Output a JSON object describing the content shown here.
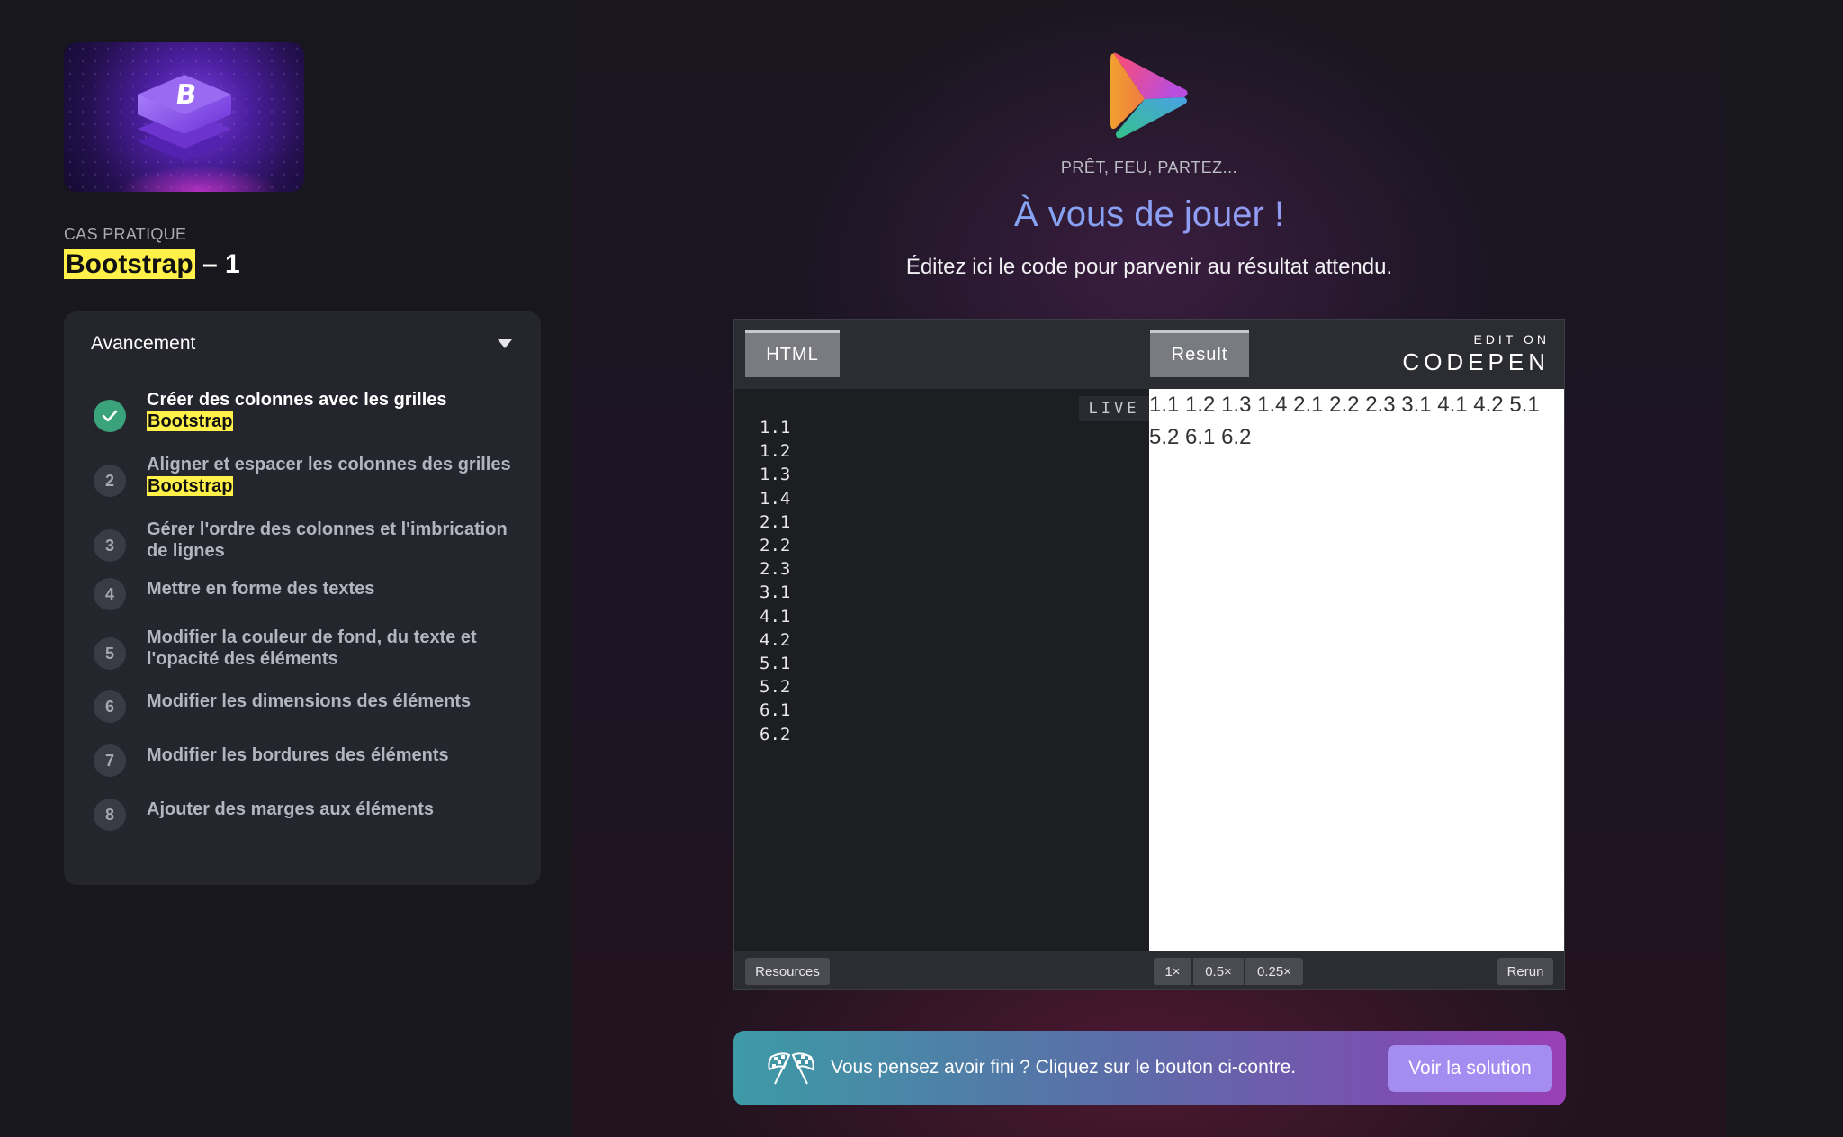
{
  "sidebar": {
    "category": "CAS PRATIQUE",
    "course_title_highlight": "Bootstrap",
    "course_title_rest": " – 1",
    "progress_title": "Avancement",
    "steps": [
      {
        "num": "",
        "done": true,
        "text": "Créer des colonnes avec les grilles",
        "highlight": "Bootstrap"
      },
      {
        "num": "2",
        "done": false,
        "text": "Aligner et espacer les colonnes des grilles",
        "highlight": "Bootstrap"
      },
      {
        "num": "3",
        "done": false,
        "text": "Gérer l'ordre des colonnes et l'imbrication de lignes",
        "highlight": ""
      },
      {
        "num": "4",
        "done": false,
        "text": "Mettre en forme des textes",
        "highlight": ""
      },
      {
        "num": "5",
        "done": false,
        "text": "Modifier la couleur de fond, du texte et l'opacité des éléments",
        "highlight": ""
      },
      {
        "num": "6",
        "done": false,
        "text": "Modifier les dimensions des éléments",
        "highlight": ""
      },
      {
        "num": "7",
        "done": false,
        "text": "Modifier les bordures des éléments",
        "highlight": ""
      },
      {
        "num": "8",
        "done": false,
        "text": "Ajouter des marges aux éléments",
        "highlight": ""
      }
    ]
  },
  "main": {
    "eyebrow": "PRÊT, FEU, PARTEZ...",
    "title": "À vous de jouer !",
    "subtitle": "Éditez ici le code pour parvenir au résultat attendu."
  },
  "codepen": {
    "tab_html": "HTML",
    "tab_result": "Result",
    "edit_on": "EDIT ON",
    "brand": "CODEPEN",
    "live": "LIVE",
    "code_lines": [
      "1.1",
      "1.2",
      "1.3",
      "1.4",
      "2.1",
      "2.2",
      "2.3",
      "3.1",
      "4.1",
      "4.2",
      "5.1",
      "5.2",
      "6.1",
      "6.2"
    ],
    "result_text": "1.1 1.2 1.3 1.4 2.1 2.2 2.3 3.1 4.1 4.2 5.1 5.2 6.1 6.2",
    "resources": "Resources",
    "zoom_1x": "1×",
    "zoom_05x": "0.5×",
    "zoom_025x": "0.25×",
    "rerun": "Rerun"
  },
  "banner": {
    "text": "Vous pensez avoir fini ? Cliquez sur le bouton ci-contre.",
    "button": "Voir la solution"
  },
  "colors": {
    "highlight": "#fff14a",
    "done": "#3aa37c",
    "accent": "#a58cf0"
  }
}
